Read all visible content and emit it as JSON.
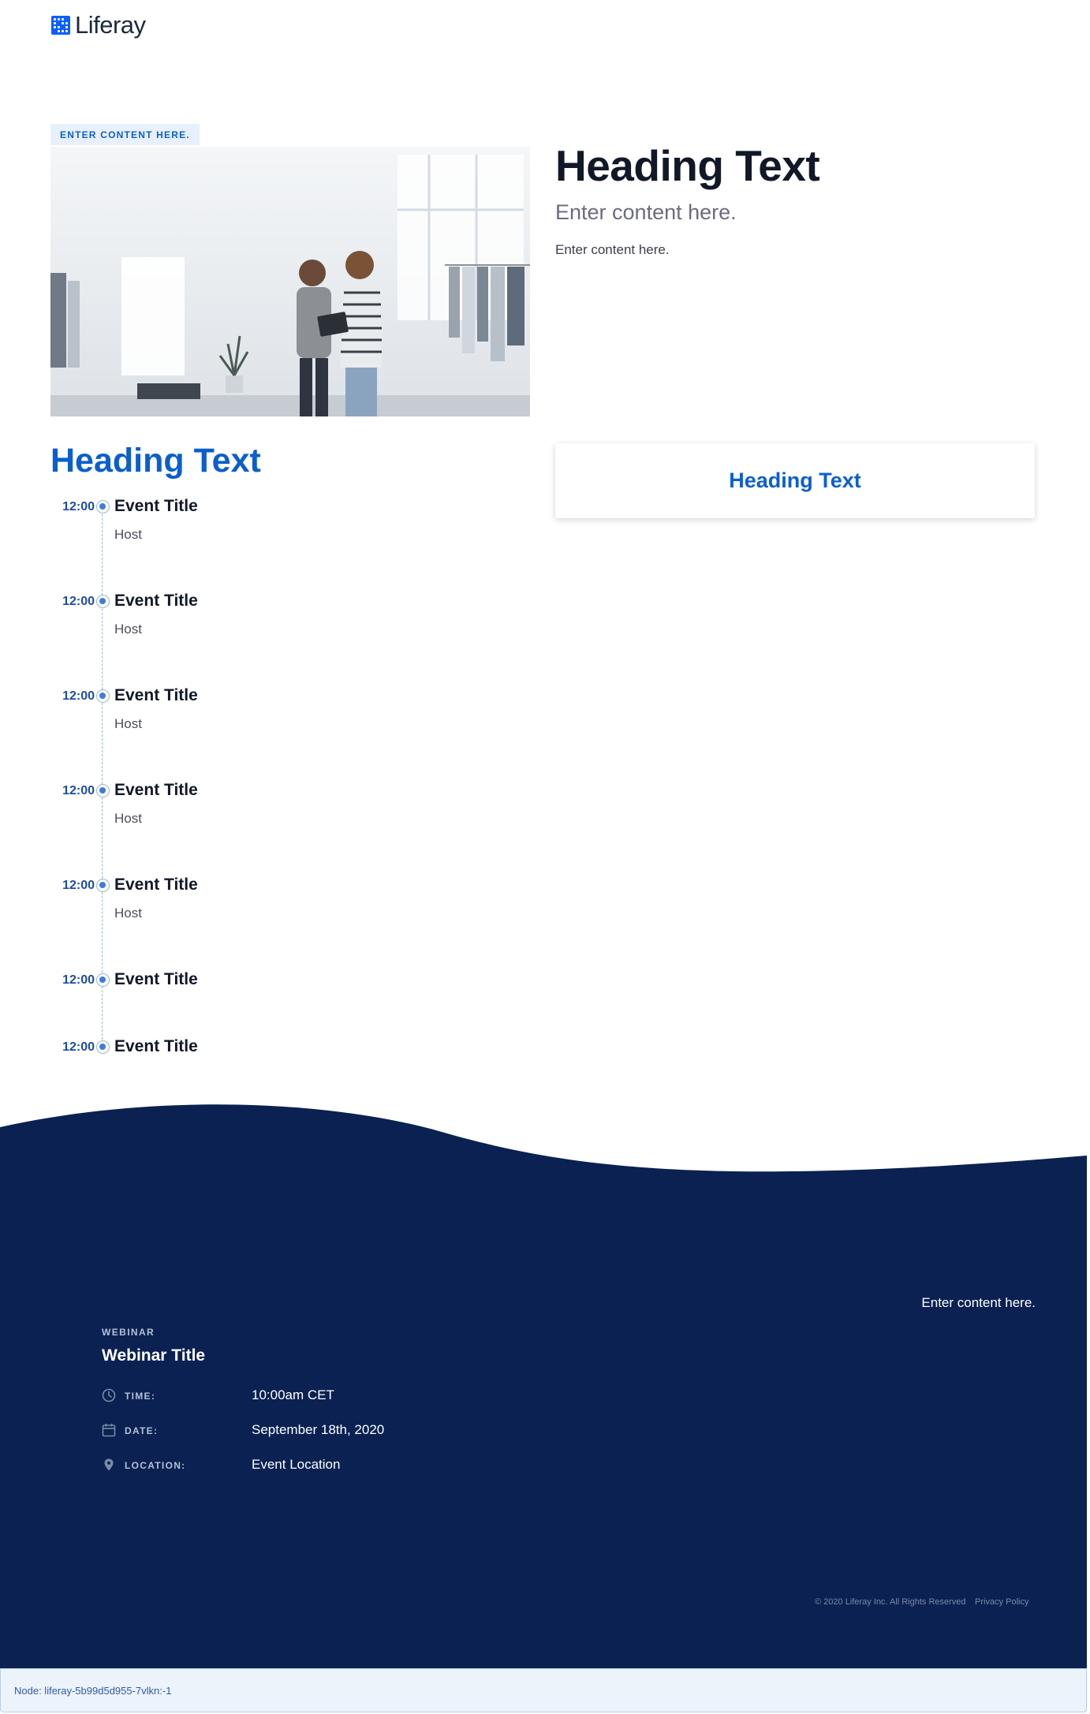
{
  "header": {
    "logo_text": "Liferay"
  },
  "hero": {
    "badge": "ENTER CONTENT HERE.",
    "image_icon": "store-photo-two-people-with-tablet",
    "title": "Heading Text",
    "subtitle": "Enter content here.",
    "body": "Enter content here."
  },
  "agenda": {
    "title": "Heading Text",
    "events": [
      {
        "time": "12:00",
        "title": "Event Title",
        "host": "Host"
      },
      {
        "time": "12:00",
        "title": "Event Title",
        "host": "Host"
      },
      {
        "time": "12:00",
        "title": "Event Title",
        "host": "Host"
      },
      {
        "time": "12:00",
        "title": "Event Title",
        "host": "Host"
      },
      {
        "time": "12:00",
        "title": "Event Title",
        "host": "Host"
      },
      {
        "time": "12:00",
        "title": "Event Title"
      },
      {
        "time": "12:00",
        "title": "Event Title"
      }
    ]
  },
  "card": {
    "title": "Heading Text"
  },
  "footer": {
    "right_text": "Enter content here.",
    "webinar_label": "WEBINAR",
    "webinar_title": "Webinar Title",
    "details": [
      {
        "icon": "clock-icon",
        "label": "TIME:",
        "value": "10:00am CET"
      },
      {
        "icon": "calendar-icon",
        "label": "DATE:",
        "value": "September 18th, 2020"
      },
      {
        "icon": "location-pin-icon",
        "label": "LOCATION:",
        "value": "Event Location"
      }
    ],
    "copyright": "© 2020 Liferay Inc. All Rights Reserved",
    "privacy": "Privacy Policy"
  },
  "node_bar": {
    "text": "Node: liferay-5b99d5d955-7vlkn:-1"
  },
  "colors": {
    "brand_blue": "#0b5fcc",
    "footer_navy": "#0a2152",
    "timeline_dot": "#3f7be0"
  }
}
